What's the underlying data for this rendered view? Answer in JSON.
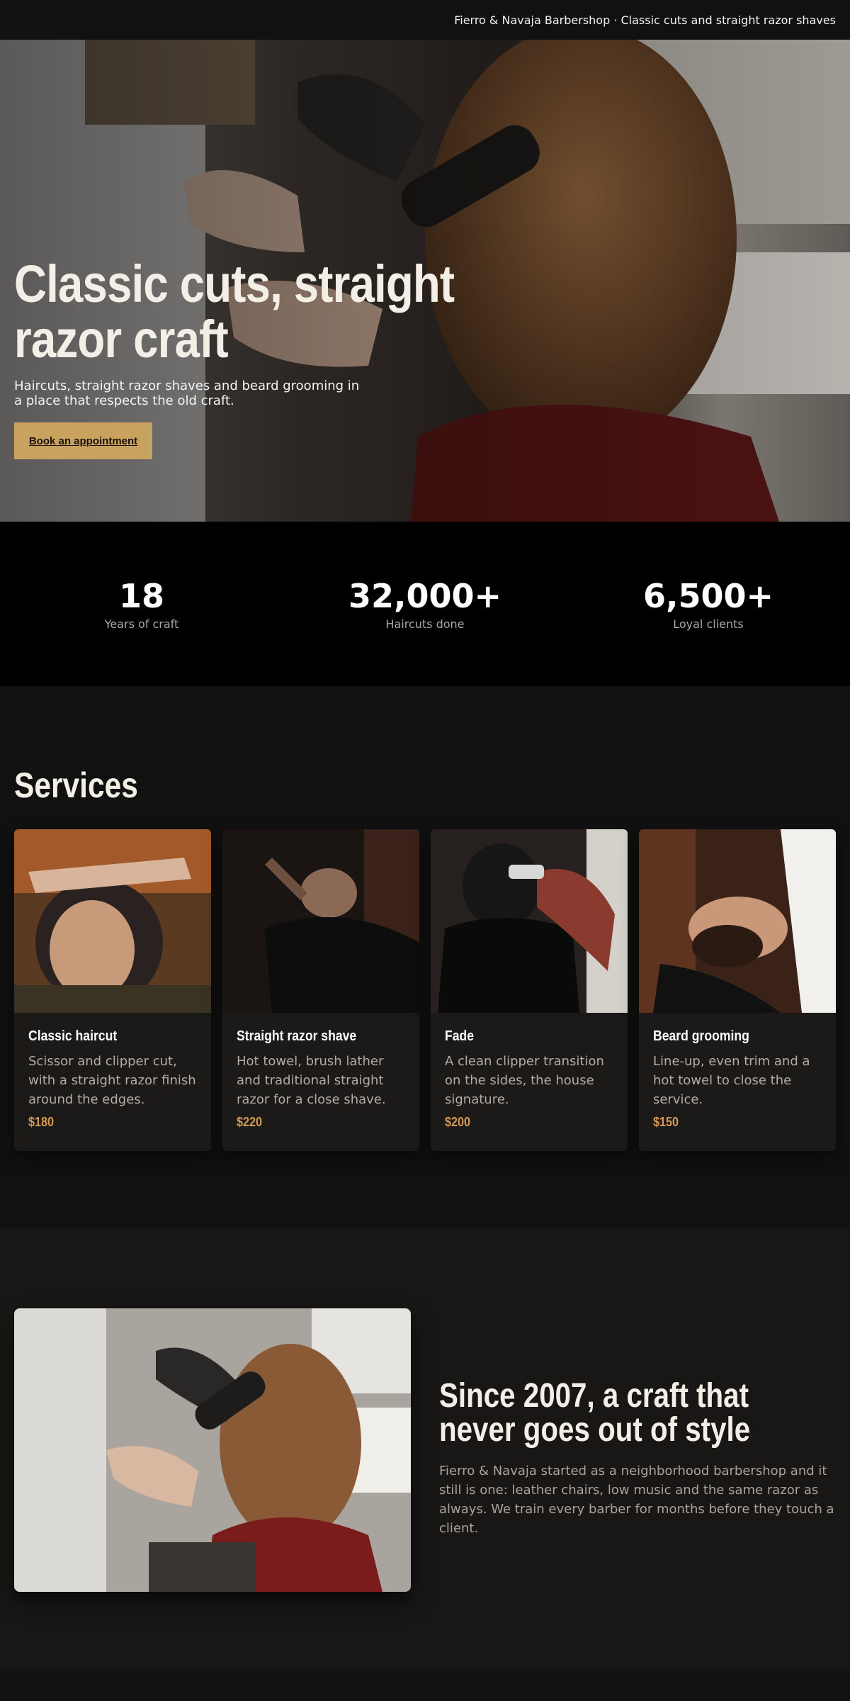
{
  "topbar": {
    "text": "Fierro & Navaja Barbershop · Classic cuts and straight razor shaves"
  },
  "hero": {
    "title": "Classic cuts, straight razor craft",
    "subtitle": "Haircuts, straight razor shaves and beard grooming in a place that respects the old craft.",
    "cta_label": "Book an appointment"
  },
  "stats": [
    {
      "value": "18",
      "label": "Years of craft"
    },
    {
      "value": "32,000+",
      "label": "Haircuts done"
    },
    {
      "value": "6,500+",
      "label": "Loyal clients"
    }
  ],
  "services": {
    "title": "Services",
    "items": [
      {
        "title": "Classic haircut",
        "desc": "Scissor and clipper cut, with a straight razor finish around the edges.",
        "price": "$180"
      },
      {
        "title": "Straight razor shave",
        "desc": "Hot towel, brush lather and traditional straight razor for a close shave.",
        "price": "$220"
      },
      {
        "title": "Fade",
        "desc": "A clean clipper transition on the sides, the house signature.",
        "price": "$200"
      },
      {
        "title": "Beard grooming",
        "desc": "Line-up, even trim and a hot towel to close the service.",
        "price": "$150"
      }
    ]
  },
  "about": {
    "title": "Since 2007, a craft that never goes out of style",
    "body": "Fierro & Navaja started as a neighborhood barbershop and it still is one: leather chairs, low music and the same razor as always. We train every barber for months before they touch a client."
  },
  "colors": {
    "accent": "#c9a25f",
    "price": "#d39a56",
    "background": "#111111"
  }
}
